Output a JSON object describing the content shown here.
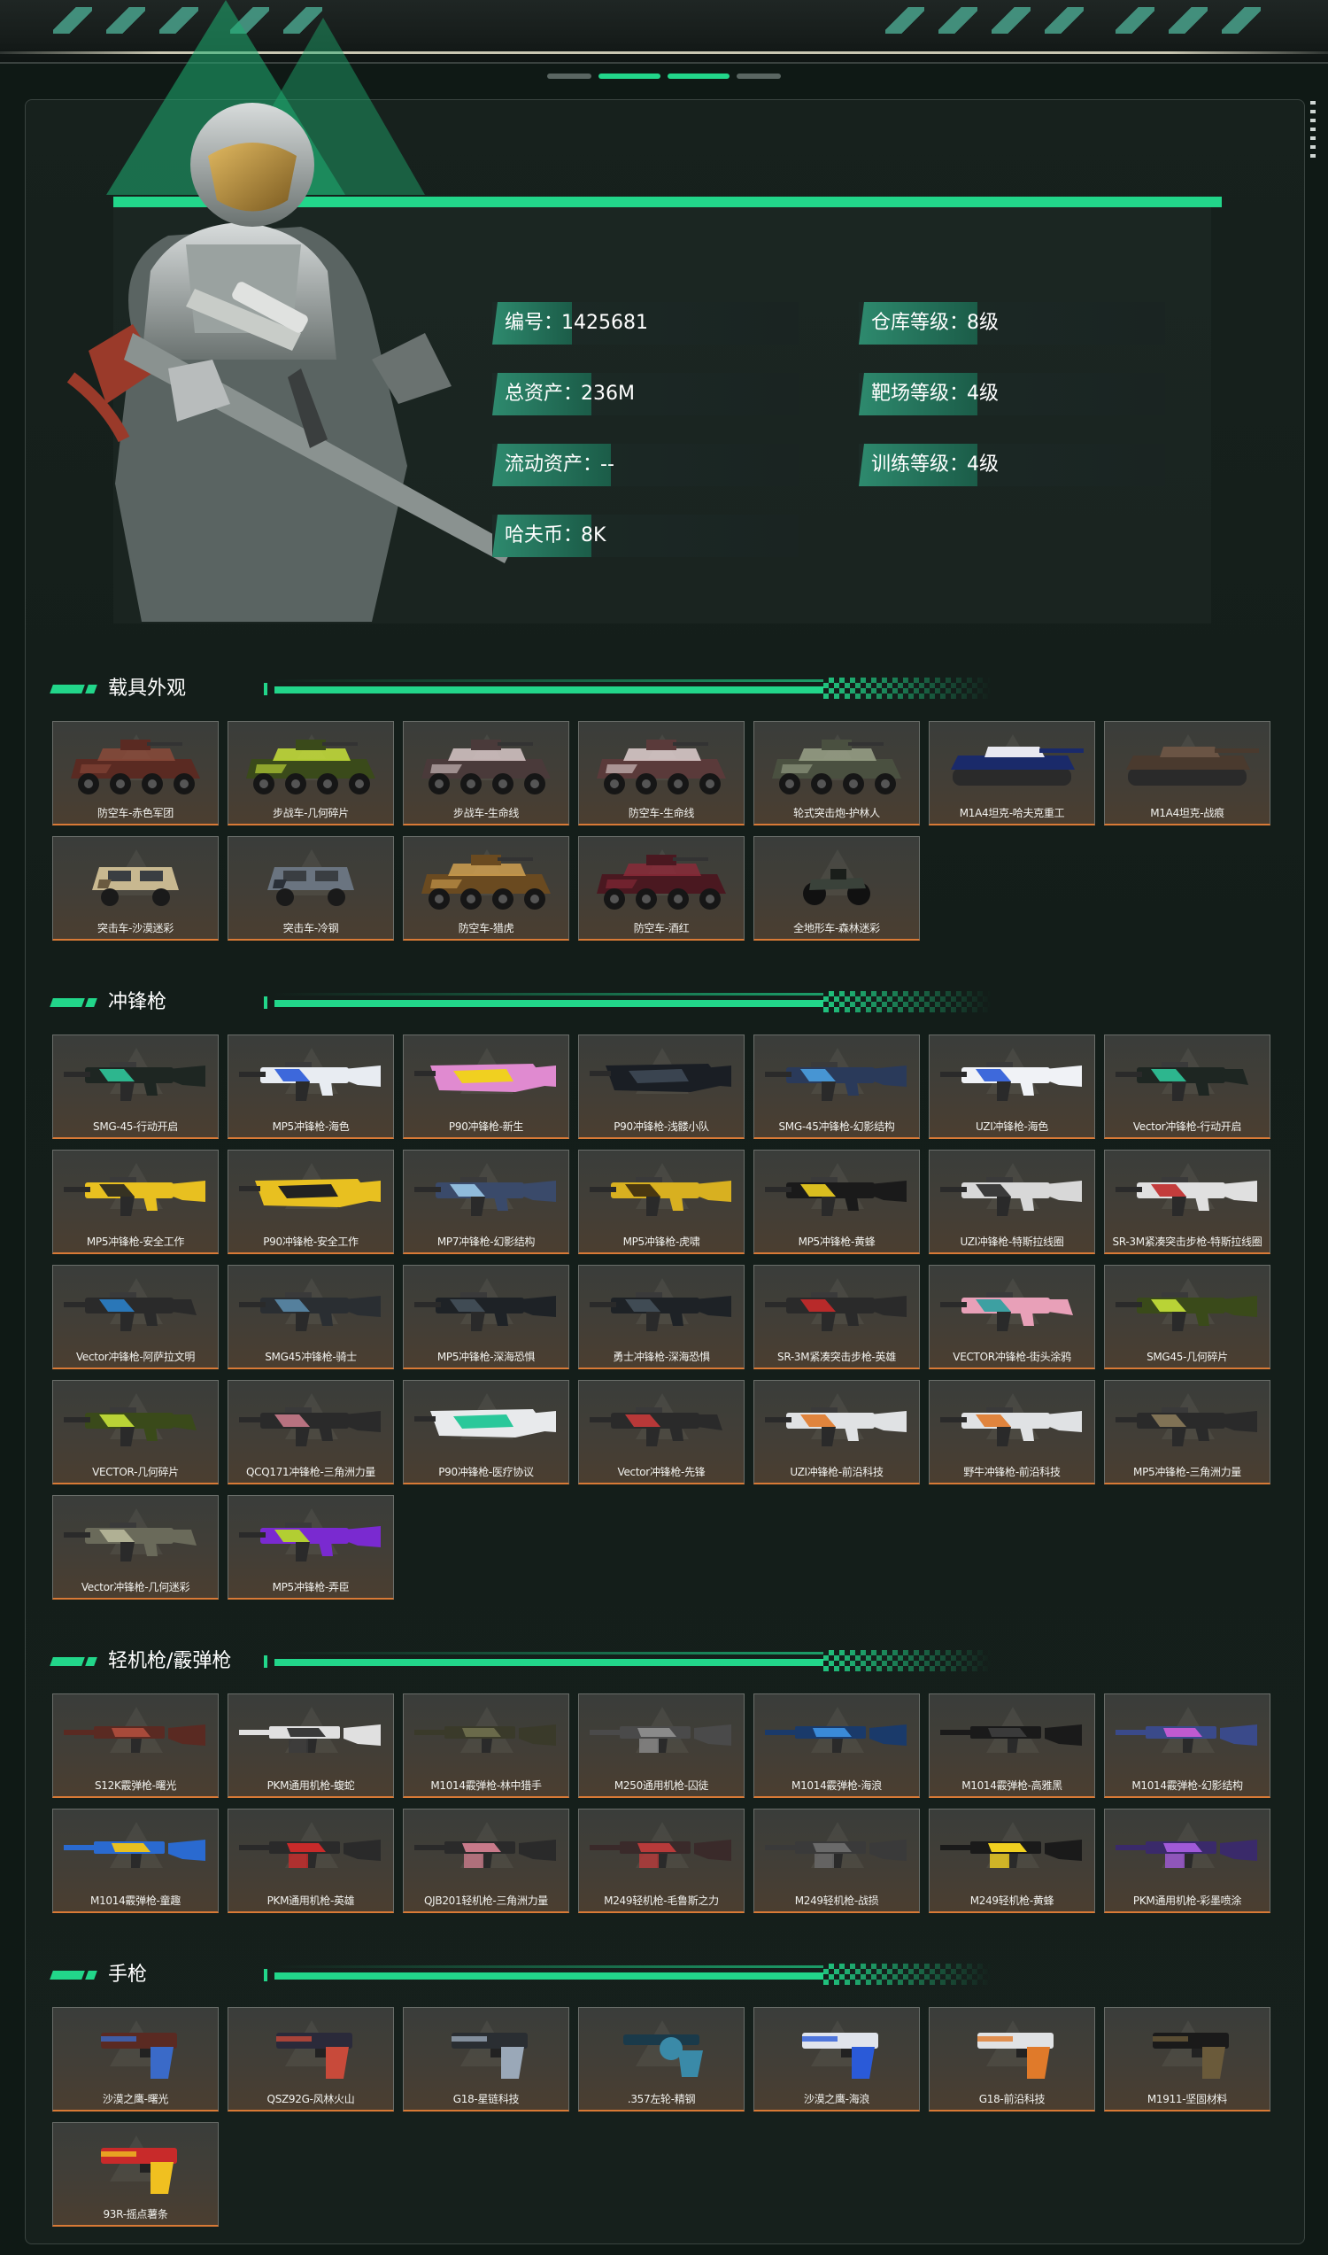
{
  "colors": {
    "accent": "#22d68a",
    "card_bottom": "#d97a36",
    "panel": "#131d19"
  },
  "profile": {
    "stats": [
      {
        "label": "编号：",
        "value": "1425681"
      },
      {
        "label": "总资产：",
        "value": "236M"
      },
      {
        "label": "流动资产：",
        "value": "--"
      },
      {
        "label": "哈夫币：",
        "value": "8K"
      },
      {
        "label": "仓库等级：",
        "value": "8级"
      },
      {
        "label": "靶场等级：",
        "value": "4级"
      },
      {
        "label": "训练等级：",
        "value": "4级"
      }
    ]
  },
  "sections": [
    {
      "title": "载具外观",
      "kind": "vehicle",
      "items": [
        {
          "name": "防空车-赤色军团",
          "icon": "apc-icon",
          "c1": "#5a2a22",
          "c2": "#8a4a3a"
        },
        {
          "name": "步战车-几何碎片",
          "icon": "apc-icon",
          "c1": "#3a4a1a",
          "c2": "#c8e23a"
        },
        {
          "name": "步战车-生命线",
          "icon": "apc-icon",
          "c1": "#4a3a3a",
          "c2": "#d8c8c8"
        },
        {
          "name": "防空车-生命线",
          "icon": "apc-icon",
          "c1": "#5a3a3a",
          "c2": "#e0d0d0"
        },
        {
          "name": "轮式突击炮-护林人",
          "icon": "apc-icon",
          "c1": "#4a5040",
          "c2": "#9aa288"
        },
        {
          "name": "M1A4坦克-哈夫克重工",
          "icon": "tank-icon",
          "c1": "#1a2a6a",
          "c2": "#e8e8f0"
        },
        {
          "name": "M1A4坦克-战痕",
          "icon": "tank-icon",
          "c1": "#4a3a2e",
          "c2": "#6a5444"
        },
        {
          "name": "突击车-沙漠迷彩",
          "icon": "jeep-icon",
          "c1": "#6a5a40",
          "c2": "#c8b890"
        },
        {
          "name": "突击车-冷钢",
          "icon": "jeep-icon",
          "c1": "#2a3038",
          "c2": "#6a7480"
        },
        {
          "name": "防空车-猎虎",
          "icon": "apc-icon",
          "c1": "#6a4a20",
          "c2": "#d0a050"
        },
        {
          "name": "防空车-酒红",
          "icon": "apc-icon",
          "c1": "#4a1820",
          "c2": "#8a2a38"
        },
        {
          "name": "全地形车-森林迷彩",
          "icon": "atv-icon",
          "c1": "#1a1e1a",
          "c2": "#3a423a"
        }
      ]
    },
    {
      "title": "冲锋枪",
      "kind": "gun",
      "items": [
        {
          "name": "SMG-45-行动开启",
          "icon": "smg-icon",
          "c1": "#1e2622",
          "c2": "#2fc79a"
        },
        {
          "name": "MP5冲锋枪-海色",
          "icon": "smg-icon",
          "c1": "#e8ecf2",
          "c2": "#2a5ad8"
        },
        {
          "name": "P90冲锋枪-新生",
          "icon": "p90-icon",
          "c1": "#e08ad0",
          "c2": "#f0d020"
        },
        {
          "name": "P90冲锋枪-浅髅小队",
          "icon": "p90-icon",
          "c1": "#1a1e24",
          "c2": "#3a4450"
        },
        {
          "name": "SMG-45冲锋枪-幻影结构",
          "icon": "smg-icon",
          "c1": "#2a3a5a",
          "c2": "#4aa0e0"
        },
        {
          "name": "UZI冲锋枪-海色",
          "icon": "smg-icon",
          "c1": "#f0f2f6",
          "c2": "#2a5ad8"
        },
        {
          "name": "Vector冲锋枪-行动开启",
          "icon": "vector-icon",
          "c1": "#1e2622",
          "c2": "#2fc79a"
        },
        {
          "name": "MP5冲锋枪-安全工作",
          "icon": "smg-icon",
          "c1": "#e8c020",
          "c2": "#222"
        },
        {
          "name": "P90冲锋枪-安全工作",
          "icon": "p90-icon",
          "c1": "#e8c020",
          "c2": "#222"
        },
        {
          "name": "MP7冲锋枪-幻影结构",
          "icon": "smg-icon",
          "c1": "#3a4a6a",
          "c2": "#9ac8e8"
        },
        {
          "name": "MP5冲锋枪-虎啸",
          "icon": "smg-icon",
          "c1": "#d8b020",
          "c2": "#3a2a10"
        },
        {
          "name": "MP5冲锋枪-黄蜂",
          "icon": "smg-icon",
          "c1": "#1a1a1a",
          "c2": "#f0d020"
        },
        {
          "name": "UZI冲锋枪-特斯拉线圈",
          "icon": "smg-icon",
          "c1": "#d8d8d8",
          "c2": "#2a2a2a"
        },
        {
          "name": "SR-3M紧凑突击步枪-特斯拉线圈",
          "icon": "smg-icon",
          "c1": "#e0e0e0",
          "c2": "#c02a2a"
        },
        {
          "name": "Vector冲锋枪-阿萨拉文明",
          "icon": "vector-icon",
          "c1": "#2a2a2a",
          "c2": "#2a80c8"
        },
        {
          "name": "SMG45冲锋枪-骑士",
          "icon": "smg-icon",
          "c1": "#2a2e32",
          "c2": "#5a8aa8"
        },
        {
          "name": "MP5冲锋枪-深海恐惧",
          "icon": "smg-icon",
          "c1": "#1e2226",
          "c2": "#44505a"
        },
        {
          "name": "勇士冲锋枪-深海恐惧",
          "icon": "smg-icon",
          "c1": "#1e2226",
          "c2": "#44505a"
        },
        {
          "name": "SR-3M紧凑突击步枪-英雄",
          "icon": "smg-icon",
          "c1": "#2a2a2a",
          "c2": "#c82a2a"
        },
        {
          "name": "VECTOR冲锋枪-街头涂鸦",
          "icon": "vector-icon",
          "c1": "#e8a0b8",
          "c2": "#2aa0a0"
        },
        {
          "name": "SMG45-几何碎片",
          "icon": "smg-icon",
          "c1": "#3a4a1a",
          "c2": "#c8e23a"
        },
        {
          "name": "VECTOR-几何碎片",
          "icon": "vector-icon",
          "c1": "#3a4a1a",
          "c2": "#c8e23a"
        },
        {
          "name": "QCQ171冲锋枪-三角洲力量",
          "icon": "smg-icon",
          "c1": "#2a2a2a",
          "c2": "#c87a8a"
        },
        {
          "name": "P90冲锋枪-医疗协议",
          "icon": "p90-icon",
          "c1": "#e8eaec",
          "c2": "#2ac89a"
        },
        {
          "name": "Vector冲锋枪-先锋",
          "icon": "vector-icon",
          "c1": "#2a2a2a",
          "c2": "#c83a3a"
        },
        {
          "name": "UZI冲锋枪-前沿科技",
          "icon": "smg-icon",
          "c1": "#e0e2e4",
          "c2": "#e07a2a"
        },
        {
          "name": "野牛冲锋枪-前沿科技",
          "icon": "smg-icon",
          "c1": "#e0e2e4",
          "c2": "#e07a2a"
        },
        {
          "name": "MP5冲锋枪-三角洲力量",
          "icon": "smg-icon",
          "c1": "#2a2a2a",
          "c2": "#8a7a5a"
        },
        {
          "name": "Vector冲锋枪-几何迷彩",
          "icon": "vector-icon",
          "c1": "#6a6a5a",
          "c2": "#b8b89a"
        },
        {
          "name": "MP5冲锋枪-弄臣",
          "icon": "smg-icon",
          "c1": "#7a2ad0",
          "c2": "#b8e020"
        }
      ]
    },
    {
      "title": "轻机枪/霰弹枪",
      "kind": "gun",
      "items": [
        {
          "name": "S12K霰弹枪-曙光",
          "icon": "shotgun-icon",
          "c1": "#5a2a22",
          "c2": "#a84a3a"
        },
        {
          "name": "PKM通用机枪-蝮蛇",
          "icon": "lmg-icon",
          "c1": "#e0e0e0",
          "c2": "#3a3a3a"
        },
        {
          "name": "M1014霰弹枪-林中猎手",
          "icon": "shotgun-icon",
          "c1": "#3a3a2a",
          "c2": "#6a6a4a"
        },
        {
          "name": "M250通用机枪-囚徒",
          "icon": "lmg-icon",
          "c1": "#4a4a4a",
          "c2": "#8a8a8a"
        },
        {
          "name": "M1014霰弹枪-海浪",
          "icon": "shotgun-icon",
          "c1": "#1a3a6a",
          "c2": "#3a8ad8"
        },
        {
          "name": "M1014霰弹枪-高雅黑",
          "icon": "shotgun-icon",
          "c1": "#1a1a1a",
          "c2": "#3a3a3a"
        },
        {
          "name": "M1014霰弹枪-幻影结构",
          "icon": "shotgun-icon",
          "c1": "#3a4a8a",
          "c2": "#c05ad0"
        },
        {
          "name": "M1014霰弹枪-童趣",
          "icon": "shotgun-icon",
          "c1": "#2a6ad0",
          "c2": "#e8c020"
        },
        {
          "name": "PKM通用机枪-英雄",
          "icon": "lmg-icon",
          "c1": "#2a2a2a",
          "c2": "#c82a2a"
        },
        {
          "name": "QJB201轻机枪-三角洲力量",
          "icon": "lmg-icon",
          "c1": "#2a2a2a",
          "c2": "#c87a8a"
        },
        {
          "name": "M249轻机枪-毛鲁斯之力",
          "icon": "lmg-icon",
          "c1": "#3a2a2a",
          "c2": "#b83a3a"
        },
        {
          "name": "M249轻机枪-战损",
          "icon": "lmg-icon",
          "c1": "#3a3a3a",
          "c2": "#6a6a6a"
        },
        {
          "name": "M249轻机枪-黄蜂",
          "icon": "lmg-icon",
          "c1": "#1a1a1a",
          "c2": "#f0d020"
        },
        {
          "name": "PKM通用机枪-彩墨喷涂",
          "icon": "lmg-icon",
          "c1": "#3a2a6a",
          "c2": "#a05ad8"
        }
      ]
    },
    {
      "title": "手枪",
      "kind": "pistol",
      "items": [
        {
          "name": "沙漠之鹰-曙光",
          "icon": "pistol-icon",
          "c1": "#5a2a22",
          "c2": "#3a6ac8"
        },
        {
          "name": "QSZ92G-风林火山",
          "icon": "pistol-icon",
          "c1": "#2a2a3a",
          "c2": "#c84a3a"
        },
        {
          "name": "G18-星链科技",
          "icon": "pistol-icon",
          "c1": "#2a2e32",
          "c2": "#9aa8b8"
        },
        {
          "name": ".357左轮-精钢",
          "icon": "revolver-icon",
          "c1": "#1a3a4a",
          "c2": "#3a8aa8"
        },
        {
          "name": "沙漠之鹰-海浪",
          "icon": "pistol-icon",
          "c1": "#e0e4ec",
          "c2": "#2a5ad8"
        },
        {
          "name": "G18-前沿科技",
          "icon": "pistol-icon",
          "c1": "#e0e2e4",
          "c2": "#e07a2a"
        },
        {
          "name": "M1911-坚固材料",
          "icon": "pistol-icon",
          "c1": "#1a1a1a",
          "c2": "#6a5a3a"
        },
        {
          "name": "93R-摇点薯条",
          "icon": "pistol-icon",
          "c1": "#c82a2a",
          "c2": "#f0c020"
        }
      ]
    }
  ]
}
